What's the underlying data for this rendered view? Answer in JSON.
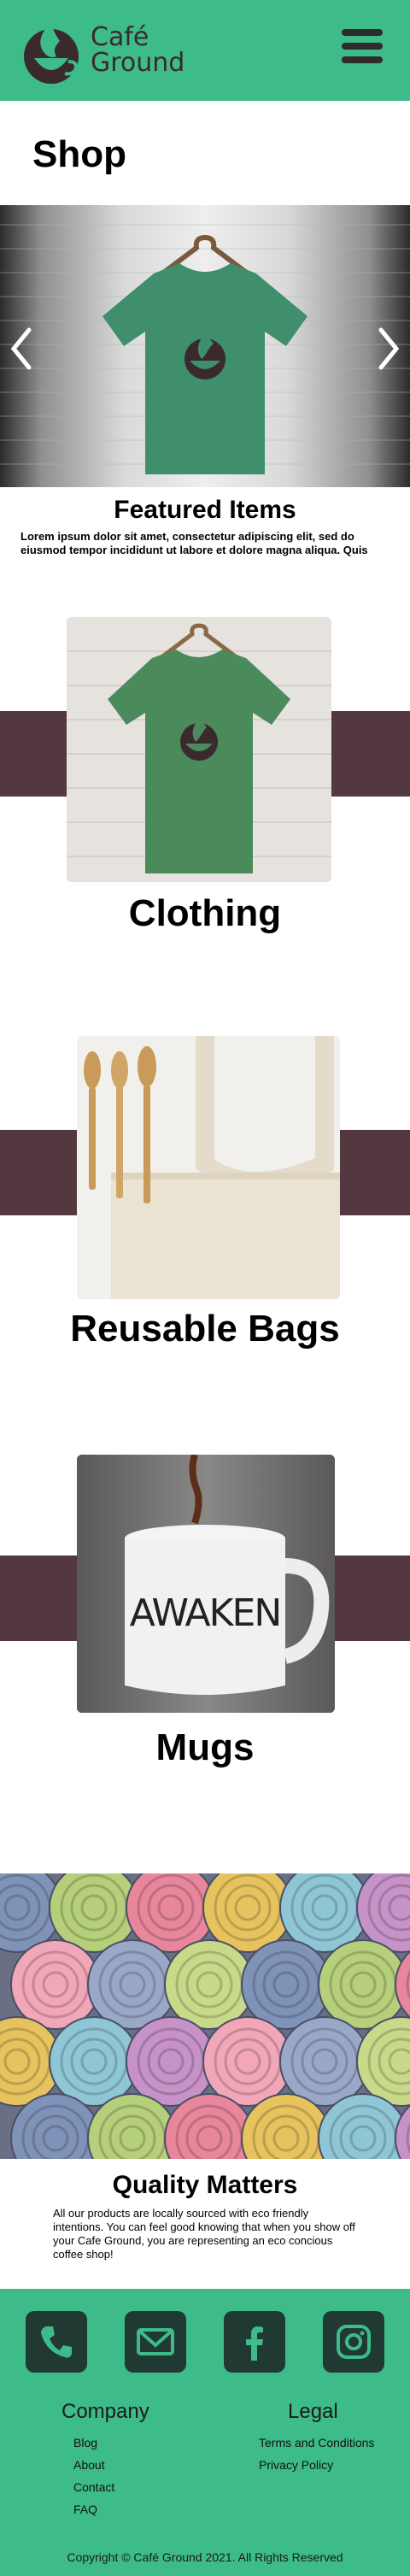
{
  "header": {
    "brand_line1": "Café",
    "brand_line2": "Ground",
    "menu_icon": "hamburger-icon"
  },
  "page": {
    "title": "Shop"
  },
  "carousel": {
    "prev_icon": "chevron-left-icon",
    "next_icon": "chevron-right-icon",
    "image": "green-tshirt-on-hanger",
    "title": "Featured Items",
    "text": "Lorem ipsum dolor sit amet, consectetur adipiscing elit, sed do eiusmod tempor incididunt ut labore et dolore magna aliqua. Quis"
  },
  "categories": [
    {
      "label": "Clothing",
      "image": "green-tshirt"
    },
    {
      "label": "Reusable Bags",
      "image": "tote-bag-and-wooden-utensils"
    },
    {
      "label": "Mugs",
      "image": "awaken-mug"
    }
  ],
  "mug_text": "AWAKEN",
  "quality": {
    "image": "folded-colorful-towels",
    "title": "Quality Matters",
    "text": "All our products are locally sourced with eco friendly intentions. You can feel good knowing that when you show off your Cafe Ground, you are representing an eco concious coffee shop!"
  },
  "footer": {
    "socials": [
      "phone-icon",
      "mail-icon",
      "facebook-icon",
      "instagram-icon"
    ],
    "company": {
      "heading": "Company",
      "links": [
        "Blog",
        "About",
        "Contact",
        "FAQ"
      ]
    },
    "legal": {
      "heading": "Legal",
      "links": [
        "Terms and Conditions",
        "Privacy Policy"
      ]
    },
    "copyright": "Copyright © Café Ground 2021. All Rights Reserved"
  },
  "colors": {
    "brand_green": "#3dbb88",
    "band_plum": "#54383f",
    "logo_dark": "#3a2a2e",
    "icon_tile": "#203a33"
  }
}
